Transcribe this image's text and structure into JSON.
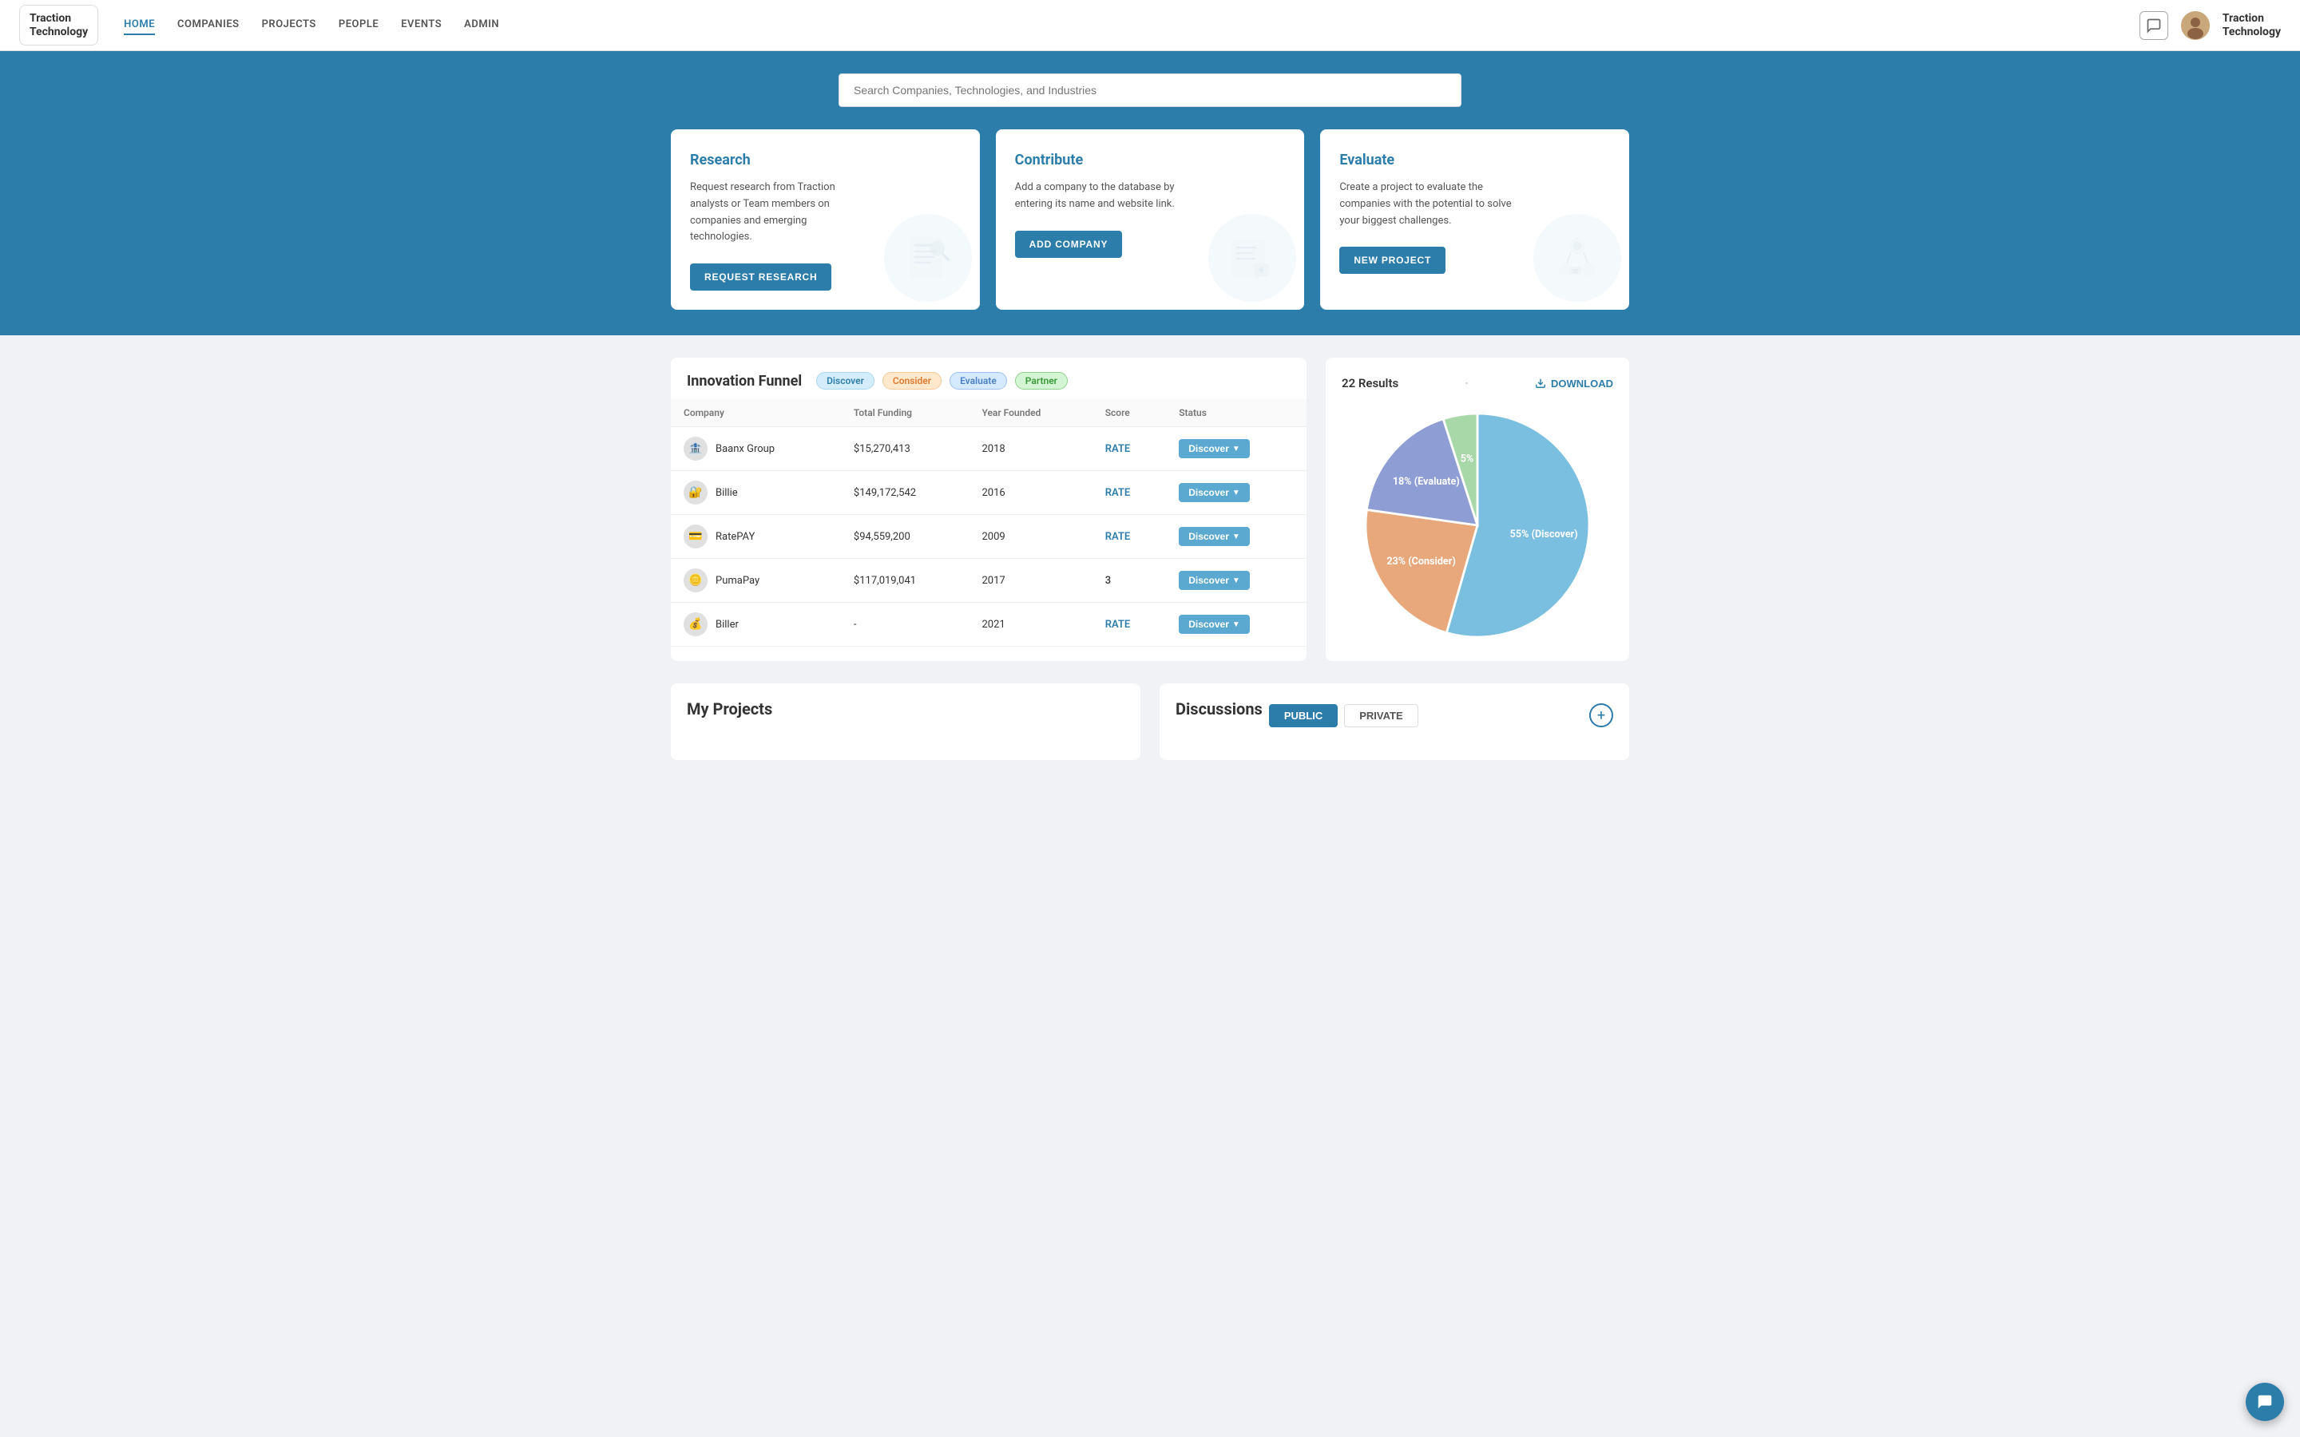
{
  "navbar": {
    "logo_line1": "Traction",
    "logo_line2": "Technology",
    "links": [
      {
        "label": "HOME",
        "active": true
      },
      {
        "label": "COMPANIES",
        "active": false
      },
      {
        "label": "PROJECTS",
        "active": false
      },
      {
        "label": "PEOPLE",
        "active": false
      },
      {
        "label": "EVENTS",
        "active": false
      },
      {
        "label": "ADMIN",
        "active": false
      }
    ],
    "brand_line1": "Traction",
    "brand_line2": "Technology"
  },
  "hero": {
    "search_placeholder": "Search Companies, Technologies, and Industries"
  },
  "cards": [
    {
      "id": "research",
      "title": "Research",
      "desc": "Request research from Traction analysts or Team members on companies and emerging technologies.",
      "btn_label": "REQUEST RESEARCH"
    },
    {
      "id": "contribute",
      "title": "Contribute",
      "desc": "Add a company to the database by entering its name and website link.",
      "btn_label": "ADD COMPANY"
    },
    {
      "id": "evaluate",
      "title": "Evaluate",
      "desc": "Create a project to evaluate the companies with the potential to solve your biggest challenges.",
      "btn_label": "NEW PROJECT"
    }
  ],
  "funnel": {
    "title": "Innovation Funnel",
    "badges": [
      {
        "label": "Discover",
        "type": "discover"
      },
      {
        "label": "Consider",
        "type": "consider"
      },
      {
        "label": "Evaluate",
        "type": "evaluate"
      },
      {
        "label": "Partner",
        "type": "partner"
      }
    ],
    "table": {
      "columns": [
        "Company",
        "Total Funding",
        "Year Founded",
        "Score",
        "Status"
      ],
      "rows": [
        {
          "logo": "🏦",
          "name": "Baanx Group",
          "funding": "$15,270,413",
          "year": "2018",
          "score": "RATE",
          "status": "Discover"
        },
        {
          "logo": "🔐",
          "name": "Billie",
          "funding": "$149,172,542",
          "year": "2016",
          "score": "RATE",
          "status": "Discover"
        },
        {
          "logo": "💳",
          "name": "RatePAY",
          "funding": "$94,559,200",
          "year": "2009",
          "score": "RATE",
          "status": "Discover"
        },
        {
          "logo": "🪙",
          "name": "PumaPay",
          "funding": "$117,019,041",
          "year": "2017",
          "score": "3",
          "status": "Discover"
        },
        {
          "logo": "💰",
          "name": "Biller",
          "funding": "-",
          "year": "2021",
          "score": "RATE",
          "status": "Discover"
        }
      ]
    }
  },
  "results": {
    "count_label": "22 Results",
    "download_label": "DOWNLOAD",
    "pie": {
      "segments": [
        {
          "label": "55% (Discover)",
          "percent": 55,
          "color": "#7bbfe0"
        },
        {
          "label": "23% (Consider)",
          "percent": 23,
          "color": "#e8a87c"
        },
        {
          "label": "18% (Evaluate)",
          "percent": 18,
          "color": "#8e9dd4"
        },
        {
          "label": "5%",
          "percent": 5,
          "color": "#a8d8a8"
        }
      ]
    }
  },
  "my_projects": {
    "title": "My Projects"
  },
  "discussions": {
    "title": "Discussions",
    "tabs": [
      {
        "label": "PUBLIC",
        "active": true
      },
      {
        "label": "PRIVATE",
        "active": false
      }
    ]
  }
}
